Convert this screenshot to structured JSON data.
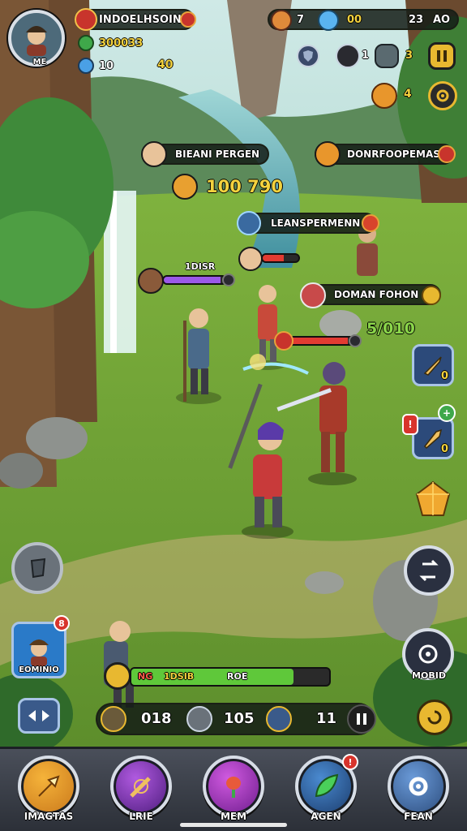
{
  "colors": {
    "gold": "#f3d23e",
    "green": "#8bd64a",
    "health_red": "#e23b32",
    "mana_purple": "#9b59e8",
    "panel_dark": "#141c16",
    "badge_red": "#d8342c"
  },
  "player": {
    "portrait_label": "ME",
    "name": "INDOELHSOIN",
    "gold": "300033",
    "level": "10",
    "xp_hint": "40"
  },
  "resources": {
    "fox_count": "7",
    "gem_count": "00",
    "right_value_a": "23",
    "right_value_b": "AO",
    "shield_icon": "shield-icon",
    "compass_value": "1",
    "cube_value": "3",
    "pause_icon": "pause-icon",
    "cat_value": "4",
    "gear_icon": "gear-icon"
  },
  "units": {
    "left_tag": "BIEANI PERGEN",
    "left_score": "100 790",
    "right_tag": "DONRFOOPEMAS",
    "mid_tag": "LEANSPERMENN",
    "purple_label": "1DISR",
    "cloud_label": "DOMAN FOHON",
    "cloud_score": "5/010"
  },
  "side_right": {
    "sword_count": "0",
    "blade_count": "0",
    "blade_badge_left": "!",
    "blade_badge_top": "+",
    "camera_label": "MOBID"
  },
  "hero_card": {
    "label": "EOMINIO",
    "badge": "8"
  },
  "status_bar": {
    "title_left": "NG",
    "title_mid": "1DSIB",
    "title_right": "ROE",
    "health_pct": 0.82
  },
  "counters": {
    "item_a": "018",
    "item_b": "105",
    "item_c": "11"
  },
  "nav": [
    {
      "label": "IMAGTAS",
      "icon": "arrow-icon"
    },
    {
      "label": "LRIE",
      "icon": "sword-orb-icon"
    },
    {
      "label": "MEM",
      "icon": "flower-orb-icon"
    },
    {
      "label": "AGEN",
      "icon": "leaf-icon",
      "badge": "!"
    },
    {
      "label": "FEAN",
      "icon": "gear-icon"
    }
  ]
}
